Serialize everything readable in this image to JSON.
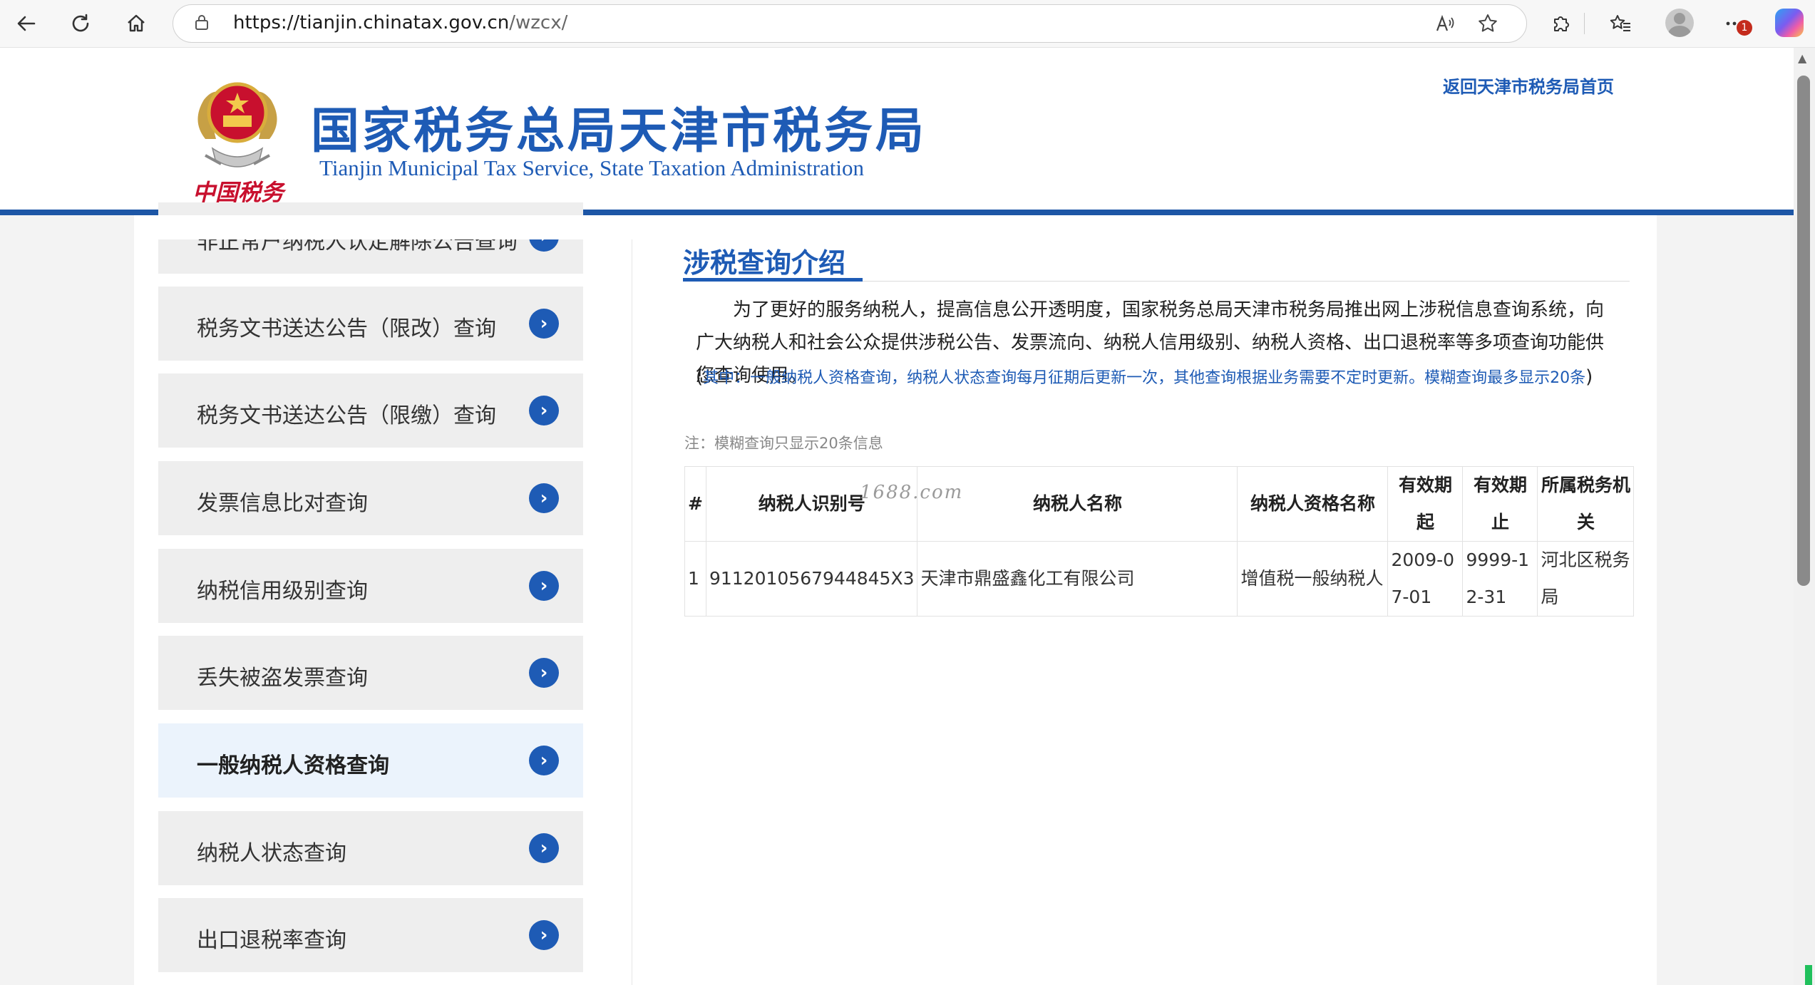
{
  "browser": {
    "url_host": "https://tianjin.chinatax.gov.cn",
    "url_path": "/wzcx/",
    "notification_count": "1"
  },
  "site": {
    "title_cn": "国家税务总局天津市税务局",
    "title_en": "Tianjin Municipal Tax Service, State Taxation Administration",
    "emblem_text": "中国税务",
    "back_home": "返回天津市税务局首页"
  },
  "sidebar": {
    "items": [
      {
        "label": "非正常户纳税人认定解除公告查询"
      },
      {
        "label": "税务文书送达公告（限改）查询"
      },
      {
        "label": "税务文书送达公告（限缴）查询"
      },
      {
        "label": "发票信息比对查询"
      },
      {
        "label": "纳税信用级别查询"
      },
      {
        "label": "丢失被盗发票查询"
      },
      {
        "label": "一般纳税人资格查询"
      },
      {
        "label": "纳税人状态查询"
      },
      {
        "label": "出口退税率查询"
      }
    ],
    "active_index": 6
  },
  "main": {
    "title": "涉税查询介绍",
    "intro": "为了更好的服务纳税人，提高信息公开透明度，国家税务总局天津市税务局推出网上涉税信息查询系统，向广大纳税人和社会公众提供涉税公告、发票流向、纳税人信用级别、纳税人资格、出口退税率等多项查询功能供您查询使用。",
    "sub_open": "(",
    "sub": "其中：一般纳税人资格查询，纳税人状态查询每月征期后更新一次，其他查询根据业务需要不定时更新。模糊查询最多显示20条",
    "sub_close": ")",
    "note": "注：模糊查询只显示20条信息",
    "watermark": "1688.com"
  },
  "table": {
    "headers": [
      "#",
      "纳税人识别号",
      "纳税人名称",
      "纳税人资格名称",
      "有效期起",
      "有效期止",
      "所属税务机关"
    ],
    "rows": [
      [
        "1",
        "9112010567944845X3",
        "天津市鼎盛鑫化工有限公司",
        "增值税一般纳税人",
        "2009-07-01",
        "9999-12-31",
        "河北区税务局"
      ]
    ]
  },
  "colors": {
    "brand_blue": "#1e5bb5",
    "header_line": "#1d56a6",
    "active_bg": "#ebf3fc"
  }
}
